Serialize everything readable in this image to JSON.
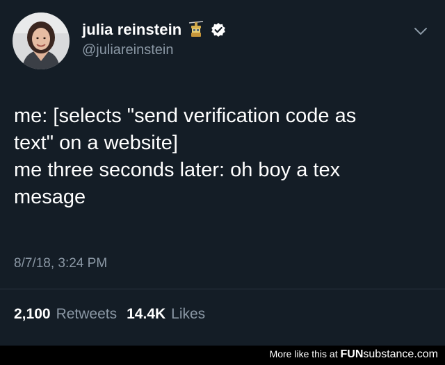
{
  "tweet": {
    "display_name": "julia reinstein",
    "handle": "@juliareinstein",
    "emoji_icon": "cable-car-icon",
    "verified_icon": "verified-badge-icon",
    "menu_icon": "chevron-down-icon",
    "text_lines": [
      "me: [selects \"send verification code as",
      "text\" on a website]",
      "me three seconds later: oh boy a tex",
      "mesage"
    ],
    "timestamp": "8/7/18, 3:24 PM",
    "retweets_count": "2,100",
    "retweets_label": "Retweets",
    "likes_count": "14.4K",
    "likes_label": "Likes"
  },
  "footer": {
    "text": "More like this at ",
    "brand_bold": "FUN",
    "brand_regular": "substance",
    "brand_suffix": ".com"
  },
  "colors": {
    "background": "#141d26",
    "secondary_text": "#8b98a5",
    "verified": "#ffffff"
  }
}
